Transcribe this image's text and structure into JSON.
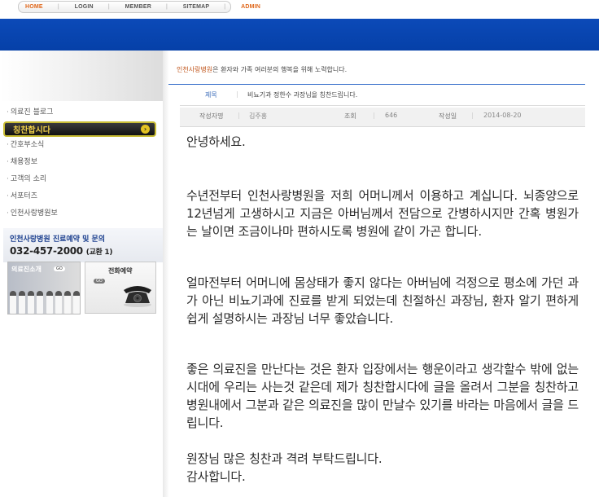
{
  "topnav": {
    "items": [
      "HOME",
      "LOGIN",
      "MEMBER",
      "SITEMAP",
      "ADMIN"
    ]
  },
  "sidebar": {
    "items": [
      "의료진 블로그",
      "칭찬합시다",
      "간호부소식",
      "채용정보",
      "고객의 소리",
      "서포터즈",
      "인천사랑병원보"
    ],
    "active_index": 1
  },
  "contact": {
    "title": "인천사랑병원 진료예약 및 문의",
    "phone": "032-457-2000",
    "ext": "(교환 1)"
  },
  "banners": {
    "doctors_label": "의료진소개",
    "doctors_go": "GO",
    "phone_label": "전화예약",
    "phone_go": "GO"
  },
  "header": {
    "hospital": "인천사랑병원",
    "slogan": "은 환자와 가족 여러분의 행복을 위해 노력합니다."
  },
  "post": {
    "title_label": "제목",
    "title": "비뇨기과 정한수 과장님을 칭찬드립니다.",
    "author_label": "작성자명",
    "author": "김주홍",
    "views_label": "조회",
    "views": "646",
    "date_label": "작성일",
    "date": "2014-08-20"
  },
  "content": {
    "greeting": "안녕하세요.",
    "p1": "수년전부터 인천사랑병원을 저희 어머니께서 이용하고 계십니다. 뇌종양으로 12년넘게 고생하시고 지금은 아버님께서 전담으로 간병하시지만 간혹 병원가는 날이면 조금이나마 편하시도록 병원에 같이 가곤 합니다.",
    "p2": "얼마전부터 어머니에 몸상태가 좋지 않다는 아버님에 걱정으로 평소에 가던 과가 아닌 비뇨기과에 진료를 받게 되었는데 친절하신 과장님, 환자 알기 편하게 쉽게 설명하시는 과장님 너무 좋았습니다.",
    "p3": "좋은 의료진을 만난다는 것은 환자 입장에서는 행운이라고 생각할수 밖에 없는 시대에 우리는 사는것 같은데 제가 칭찬합시다에 글을 올려서 그분을 칭찬하고 병원내에서 그분과 같은 의료진을 많이 만날수 있기를 바라는 마음에서 글을 드립니다.",
    "closing1": "원장님 많은 칭찬과 격려 부탁드립니다.",
    "closing2": "감사합니다."
  }
}
